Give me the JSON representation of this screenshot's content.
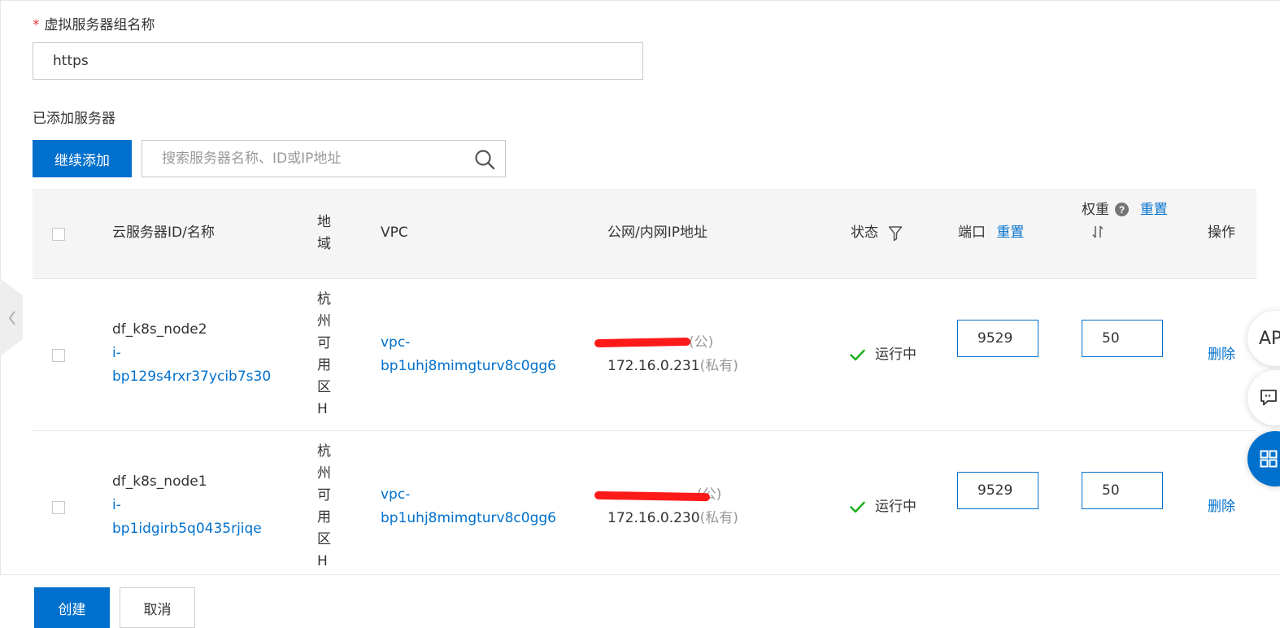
{
  "form": {
    "required_mark": "*",
    "group_name_label": "虚拟服务器组名称",
    "group_name_value": "https",
    "added_servers_label": "已添加服务器",
    "continue_add_label": "继续添加",
    "search_placeholder": "搜索服务器名称、ID或IP地址"
  },
  "table": {
    "headers": {
      "server": "云服务器ID/名称",
      "region": "地域",
      "vpc": "VPC",
      "ip": "公网/内网IP地址",
      "status": "状态",
      "port": "端口",
      "port_reset": "重置",
      "weight": "权重",
      "weight_reset": "重置",
      "action": "操作"
    },
    "rows": [
      {
        "name": "df_k8s_node2",
        "id_prefix": "i-",
        "id": "bp129s4rxr37ycib7s30",
        "region": "杭州可用区H",
        "vpc_prefix": "vpc-",
        "vpc": "bp1uhj8mimgturv8c0gg6",
        "public_ip_tag": "(公)",
        "private_ip": "172.16.0.231",
        "private_ip_tag": "(私有)",
        "status": "运行中",
        "port": "9529",
        "weight": "50",
        "action": "删除"
      },
      {
        "name": "df_k8s_node1",
        "id_prefix": "i-",
        "id": "bp1idgirb5q0435rjiqe",
        "region": "杭州可用区H",
        "vpc_prefix": "vpc-",
        "vpc": "bp1uhj8mimgturv8c0gg6",
        "public_ip_tag": "(公)",
        "private_ip": "172.16.0.230",
        "private_ip_tag": "(私有)",
        "status": "运行中",
        "port": "9529",
        "weight": "50",
        "action": "删除"
      }
    ]
  },
  "footer": {
    "create_label": "创建",
    "cancel_label": "取消"
  },
  "floating": {
    "api_label": "AP"
  },
  "colors": {
    "primary": "#0070cc",
    "success": "#1aad19",
    "redaction": "#ff1a1a"
  }
}
